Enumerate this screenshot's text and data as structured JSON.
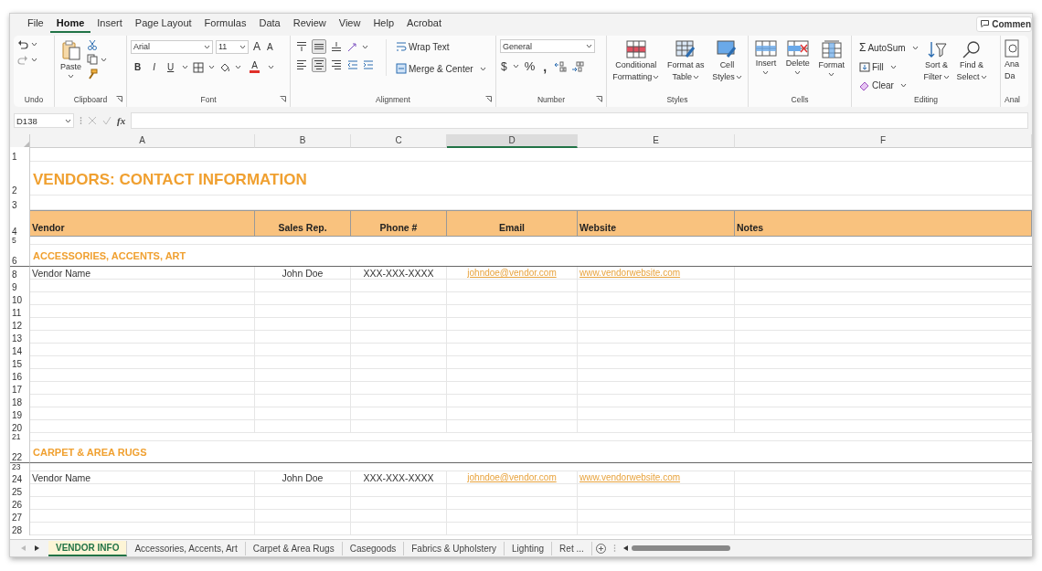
{
  "menu": {
    "tabs": [
      {
        "label": "File",
        "selected": false
      },
      {
        "label": "Home",
        "selected": true
      },
      {
        "label": "Insert",
        "selected": false
      },
      {
        "label": "Page Layout",
        "selected": false
      },
      {
        "label": "Formulas",
        "selected": false
      },
      {
        "label": "Data",
        "selected": false
      },
      {
        "label": "Review",
        "selected": false
      },
      {
        "label": "View",
        "selected": false
      },
      {
        "label": "Help",
        "selected": false
      },
      {
        "label": "Acrobat",
        "selected": false
      }
    ],
    "comments": "Commen"
  },
  "ribbon": {
    "undo": {
      "label": "Undo"
    },
    "clipboard": {
      "label": "Clipboard",
      "paste": "Paste"
    },
    "font": {
      "label": "Font",
      "name": "Arial",
      "size": "11",
      "grow": "A",
      "shrink": "A",
      "bold": "B",
      "italic": "I",
      "underline": "U",
      "color_label": "A"
    },
    "alignment": {
      "label": "Alignment",
      "vertical": [
        {
          "kind": "top",
          "selected": false
        },
        {
          "kind": "middle",
          "selected": true
        },
        {
          "kind": "bottom",
          "selected": false
        }
      ],
      "horizontal": [
        {
          "kind": "left",
          "selected": false
        },
        {
          "kind": "center",
          "selected": true
        },
        {
          "kind": "right",
          "selected": false
        }
      ],
      "wrap": "Wrap Text",
      "merge": "Merge & Center"
    },
    "number": {
      "label": "Number",
      "format": "General",
      "currency": "$",
      "percent": "%",
      "comma": ","
    },
    "styles": {
      "label": "Styles",
      "buttons": [
        {
          "kind": "conditional",
          "lines": [
            "Conditional",
            "Formatting"
          ]
        },
        {
          "kind": "table",
          "lines": [
            "Format as",
            "Table"
          ]
        },
        {
          "kind": "cellstyles",
          "lines": [
            "Cell",
            "Styles"
          ]
        }
      ]
    },
    "cells": {
      "label": "Cells",
      "buttons": [
        {
          "kind": "insert",
          "label": "Insert"
        },
        {
          "kind": "delete",
          "label": "Delete"
        },
        {
          "kind": "format",
          "label": "Format"
        }
      ]
    },
    "editing": {
      "label": "Editing",
      "sigma": "Σ",
      "autosum": "AutoSum",
      "fill": "Fill",
      "clear": "Clear",
      "buttons": [
        {
          "kind": "sort",
          "lines": [
            "Sort &",
            "Filter"
          ]
        },
        {
          "kind": "find",
          "lines": [
            "Find &",
            "Select"
          ]
        }
      ]
    },
    "analysis": {
      "label": "Anal",
      "lines": [
        "Ana",
        "Da"
      ]
    }
  },
  "formula_bar": {
    "name_box": "D138",
    "fx": "fx"
  },
  "columns": [
    {
      "label": "A",
      "selected": false
    },
    {
      "label": "B",
      "selected": false
    },
    {
      "label": "C",
      "selected": false
    },
    {
      "label": "D",
      "selected": true
    },
    {
      "label": "E",
      "selected": false
    },
    {
      "label": "F",
      "selected": false
    }
  ],
  "rows": [
    {
      "number": "1",
      "kind": "blank"
    },
    {
      "number": "2",
      "kind": "title",
      "cells": [
        "VENDORS: CONTACT INFORMATION"
      ]
    },
    {
      "number": "3",
      "kind": "blank"
    },
    {
      "number": "4",
      "kind": "header",
      "cells": [
        "Vendor",
        "Sales Rep.",
        "Phone #",
        "Email",
        "Website",
        "Notes"
      ]
    },
    {
      "number": "5",
      "kind": "spacer"
    },
    {
      "number": "6",
      "kind": "section",
      "cells": [
        "ACCESSORIES, ACCENTS, ART"
      ]
    },
    {
      "number": "8",
      "kind": "entry",
      "cells": [
        "Vendor Name",
        "John Doe",
        "XXX-XXX-XXXX",
        "johndoe@vendor.com",
        "www.vendorwebsite.com"
      ]
    },
    {
      "number": "9",
      "kind": "entry"
    },
    {
      "number": "10",
      "kind": "entry"
    },
    {
      "number": "11",
      "kind": "entry"
    },
    {
      "number": "12",
      "kind": "entry"
    },
    {
      "number": "13",
      "kind": "entry"
    },
    {
      "number": "14",
      "kind": "entry"
    },
    {
      "number": "15",
      "kind": "entry"
    },
    {
      "number": "16",
      "kind": "entry"
    },
    {
      "number": "17",
      "kind": "entry"
    },
    {
      "number": "18",
      "kind": "entry"
    },
    {
      "number": "19",
      "kind": "entry"
    },
    {
      "number": "20",
      "kind": "entry"
    },
    {
      "number": "21",
      "kind": "spacer"
    },
    {
      "number": "22",
      "kind": "section",
      "cells": [
        "CARPET & AREA RUGS"
      ]
    },
    {
      "number": "23",
      "kind": "spacer"
    },
    {
      "number": "24",
      "kind": "entry",
      "cells": [
        "Vendor Name",
        "John Doe",
        "XXX-XXX-XXXX",
        "johndoe@vendor.com",
        "www.vendorwebsite.com"
      ]
    },
    {
      "number": "25",
      "kind": "entry"
    },
    {
      "number": "26",
      "kind": "entry"
    },
    {
      "number": "27",
      "kind": "entry"
    },
    {
      "number": "28",
      "kind": "entry"
    }
  ],
  "sheet_tabs": [
    {
      "label": "VENDOR INFO",
      "selected": true
    },
    {
      "label": "Accessories, Accents, Art",
      "selected": false
    },
    {
      "label": "Carpet & Area Rugs",
      "selected": false
    },
    {
      "label": "Casegoods",
      "selected": false
    },
    {
      "label": "Fabrics & Upholstery",
      "selected": false
    },
    {
      "label": "Lighting",
      "selected": false
    },
    {
      "label": "Ret ...",
      "selected": false
    }
  ]
}
